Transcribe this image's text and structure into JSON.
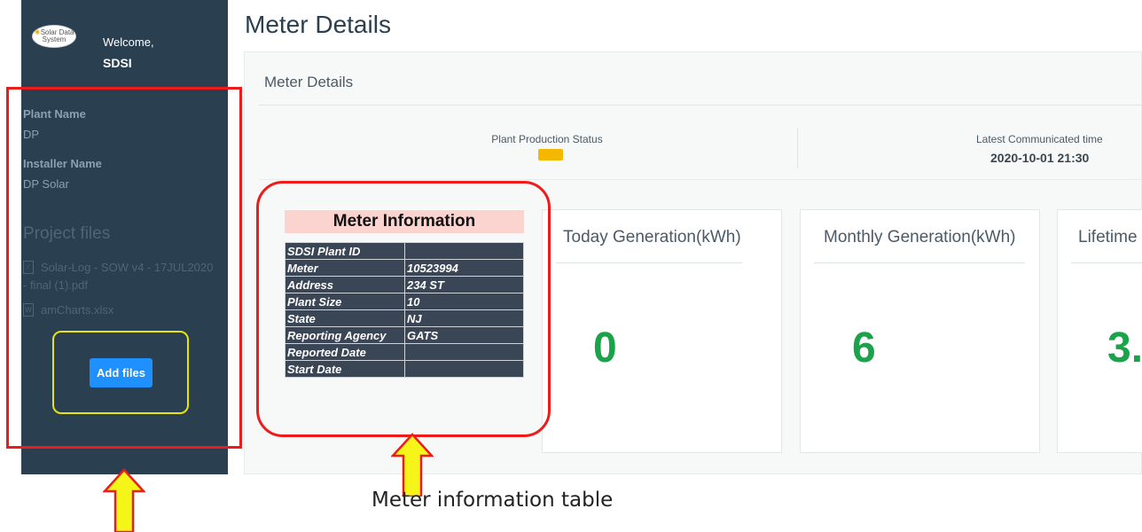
{
  "sidebar": {
    "logo_text": "Solar Data System",
    "welcome": "Welcome,",
    "username": "SDSI",
    "plant_name_label": "Plant Name",
    "plant_name_value": "DP",
    "installer_label": "Installer Name",
    "installer_value": "DP Solar",
    "project_files_title": "Project files",
    "files": [
      {
        "name": "Solar-Log - SOW v4 - 17JUL2020",
        "name_cont": "- final (1).pdf",
        "icon": "pdf-file-icon"
      },
      {
        "name": "amCharts.xlsx",
        "icon": "word-file-icon"
      }
    ],
    "add_files_label": "Add files"
  },
  "header": {
    "title": "Meter Details"
  },
  "panel": {
    "title": "Meter Details",
    "production_status_label": "Plant Production Status",
    "status_color": "#f5b800",
    "comm_label": "Latest Communicated time",
    "comm_value": "2020-10-01 21:30"
  },
  "meter_info": {
    "title": "Meter Information",
    "rows": [
      {
        "key": "SDSI Plant ID",
        "value": ""
      },
      {
        "key": "Meter",
        "value": "10523994"
      },
      {
        "key": "Address",
        "value": "234 ST"
      },
      {
        "key": "Plant Size",
        "value": "10"
      },
      {
        "key": "State",
        "value": "NJ"
      },
      {
        "key": "Reporting Agency",
        "value": "GATS"
      },
      {
        "key": "Reported Date",
        "value": ""
      },
      {
        "key": "Start Date",
        "value": ""
      }
    ]
  },
  "cards": [
    {
      "title": "Today Generation(kWh)",
      "value": "0"
    },
    {
      "title": "Monthly Generation(kWh)",
      "value": "6"
    },
    {
      "title": "Lifetime",
      "value": "3."
    }
  ],
  "annotation": {
    "caption": "Meter information table"
  },
  "colors": {
    "accent": "#1e90ff",
    "value_green": "#1aa34a",
    "highlight_red": "#ef1b1b",
    "highlight_yellow": "#e8e40c"
  }
}
